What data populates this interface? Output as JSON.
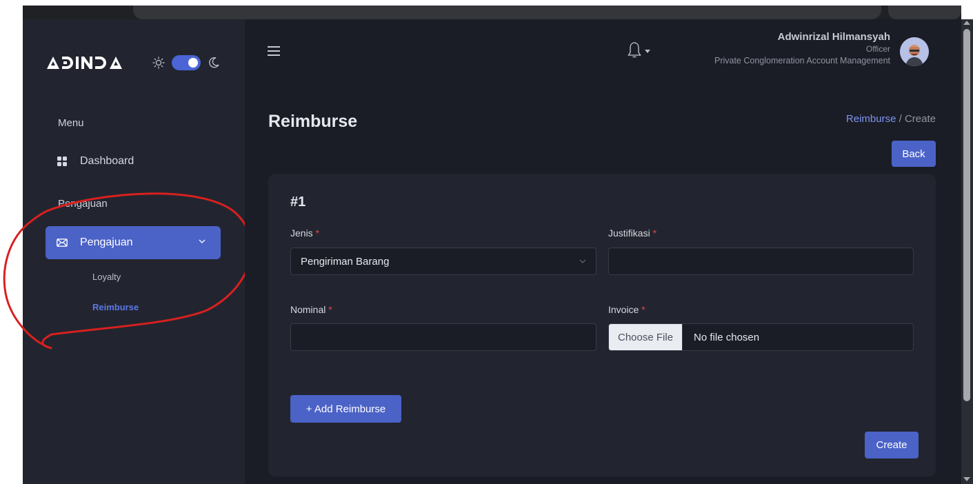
{
  "app": {
    "logo_text": "ADINDA"
  },
  "theme": {
    "mode": "dark",
    "accent": "#4b62c7",
    "sidebar_bg": "#22252f",
    "main_bg": "#1b1d26"
  },
  "sidebar": {
    "menu_heading": "Menu",
    "dashboard_label": "Dashboard",
    "section_heading": "Pengajuan",
    "active_group_label": "Pengajuan",
    "sub_items": [
      {
        "label": "Loyalty",
        "active": false
      },
      {
        "label": "Reimburse",
        "active": true
      }
    ]
  },
  "user": {
    "name": "Adwinrizal Hilmansyah",
    "role": "Officer",
    "department": "Private Conglomeration Account Management"
  },
  "page": {
    "title": "Reimburse",
    "breadcrumb_link": "Reimburse",
    "breadcrumb_sep": "/",
    "breadcrumb_current": "Create",
    "back_label": "Back"
  },
  "form": {
    "item_number": "#1",
    "jenis_label": "Jenis",
    "jenis_value": "Pengiriman Barang",
    "justifikasi_label": "Justifikasi",
    "justifikasi_value": "",
    "nominal_label": "Nominal",
    "nominal_value": "",
    "invoice_label": "Invoice",
    "choose_file_label": "Choose File",
    "no_file_text": "No file chosen",
    "required_mark": "*",
    "add_label": "+ Add Reimburse",
    "create_label": "Create"
  }
}
